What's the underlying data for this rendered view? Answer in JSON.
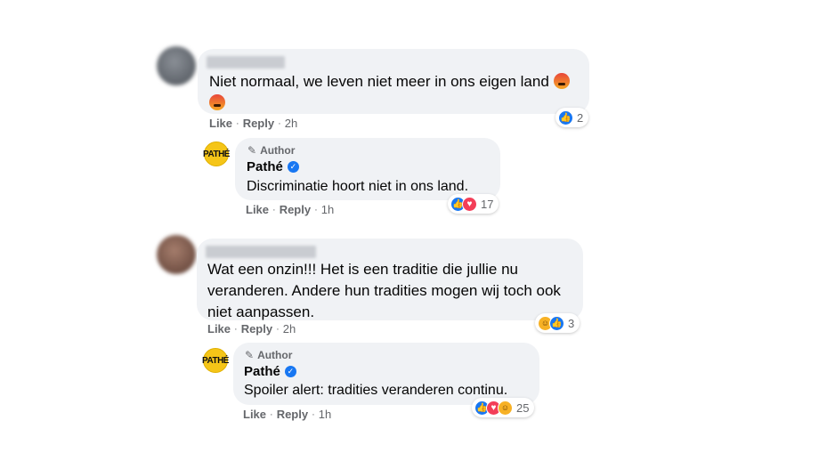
{
  "comments": [
    {
      "text_line1": "Niet normaal, we leven niet meer in ons eigen land",
      "actions": {
        "like": "Like",
        "reply": "Reply",
        "time": "2h"
      },
      "reaction_count": "2",
      "reply": {
        "author_badge": "Author",
        "name": "Pathé",
        "text": "Discriminatie hoort niet in ons land.",
        "actions": {
          "like": "Like",
          "reply": "Reply",
          "time": "1h"
        },
        "reaction_count": "17"
      }
    },
    {
      "text_line1": "Wat een onzin!!! Het is een traditie die jullie nu",
      "text_line2": "veranderen. Andere hun tradities mogen wij toch ook",
      "text_line3": "niet aanpassen.",
      "actions": {
        "like": "Like",
        "reply": "Reply",
        "time": "2h"
      },
      "reaction_count": "3",
      "reply": {
        "author_badge": "Author",
        "name": "Pathé",
        "text": "Spoiler alert: tradities veranderen continu.",
        "actions": {
          "like": "Like",
          "reply": "Reply",
          "time": "1h"
        },
        "reaction_count": "25"
      }
    }
  ],
  "dot": "·",
  "icons": {
    "angry_emoji": "angry-emoji-icon",
    "like": "like-reaction-icon",
    "love": "love-reaction-icon",
    "haha": "haha-reaction-icon",
    "verified": "verified-badge-icon",
    "pencil": "pencil-icon"
  },
  "colors": {
    "bubble": "#f0f2f5",
    "muted": "#65676b",
    "facebook_blue": "#1877f2"
  }
}
